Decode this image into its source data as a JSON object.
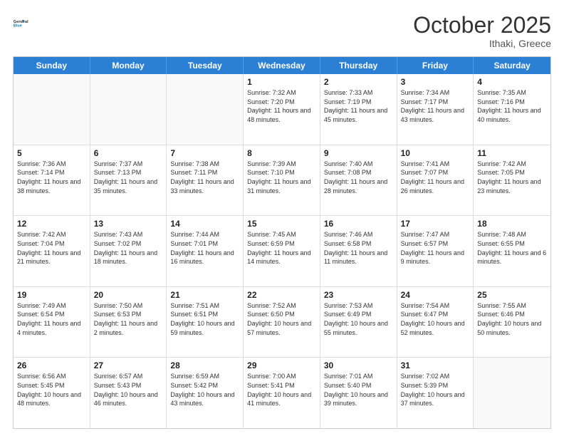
{
  "logo": {
    "line1": "General",
    "line2": "Blue"
  },
  "header": {
    "month": "October 2025",
    "location": "Ithaki, Greece"
  },
  "weekdays": [
    "Sunday",
    "Monday",
    "Tuesday",
    "Wednesday",
    "Thursday",
    "Friday",
    "Saturday"
  ],
  "rows": [
    [
      {
        "day": "",
        "info": ""
      },
      {
        "day": "",
        "info": ""
      },
      {
        "day": "",
        "info": ""
      },
      {
        "day": "1",
        "info": "Sunrise: 7:32 AM\nSunset: 7:20 PM\nDaylight: 11 hours and 48 minutes."
      },
      {
        "day": "2",
        "info": "Sunrise: 7:33 AM\nSunset: 7:19 PM\nDaylight: 11 hours and 45 minutes."
      },
      {
        "day": "3",
        "info": "Sunrise: 7:34 AM\nSunset: 7:17 PM\nDaylight: 11 hours and 43 minutes."
      },
      {
        "day": "4",
        "info": "Sunrise: 7:35 AM\nSunset: 7:16 PM\nDaylight: 11 hours and 40 minutes."
      }
    ],
    [
      {
        "day": "5",
        "info": "Sunrise: 7:36 AM\nSunset: 7:14 PM\nDaylight: 11 hours and 38 minutes."
      },
      {
        "day": "6",
        "info": "Sunrise: 7:37 AM\nSunset: 7:13 PM\nDaylight: 11 hours and 35 minutes."
      },
      {
        "day": "7",
        "info": "Sunrise: 7:38 AM\nSunset: 7:11 PM\nDaylight: 11 hours and 33 minutes."
      },
      {
        "day": "8",
        "info": "Sunrise: 7:39 AM\nSunset: 7:10 PM\nDaylight: 11 hours and 31 minutes."
      },
      {
        "day": "9",
        "info": "Sunrise: 7:40 AM\nSunset: 7:08 PM\nDaylight: 11 hours and 28 minutes."
      },
      {
        "day": "10",
        "info": "Sunrise: 7:41 AM\nSunset: 7:07 PM\nDaylight: 11 hours and 26 minutes."
      },
      {
        "day": "11",
        "info": "Sunrise: 7:42 AM\nSunset: 7:05 PM\nDaylight: 11 hours and 23 minutes."
      }
    ],
    [
      {
        "day": "12",
        "info": "Sunrise: 7:42 AM\nSunset: 7:04 PM\nDaylight: 11 hours and 21 minutes."
      },
      {
        "day": "13",
        "info": "Sunrise: 7:43 AM\nSunset: 7:02 PM\nDaylight: 11 hours and 18 minutes."
      },
      {
        "day": "14",
        "info": "Sunrise: 7:44 AM\nSunset: 7:01 PM\nDaylight: 11 hours and 16 minutes."
      },
      {
        "day": "15",
        "info": "Sunrise: 7:45 AM\nSunset: 6:59 PM\nDaylight: 11 hours and 14 minutes."
      },
      {
        "day": "16",
        "info": "Sunrise: 7:46 AM\nSunset: 6:58 PM\nDaylight: 11 hours and 11 minutes."
      },
      {
        "day": "17",
        "info": "Sunrise: 7:47 AM\nSunset: 6:57 PM\nDaylight: 11 hours and 9 minutes."
      },
      {
        "day": "18",
        "info": "Sunrise: 7:48 AM\nSunset: 6:55 PM\nDaylight: 11 hours and 6 minutes."
      }
    ],
    [
      {
        "day": "19",
        "info": "Sunrise: 7:49 AM\nSunset: 6:54 PM\nDaylight: 11 hours and 4 minutes."
      },
      {
        "day": "20",
        "info": "Sunrise: 7:50 AM\nSunset: 6:53 PM\nDaylight: 11 hours and 2 minutes."
      },
      {
        "day": "21",
        "info": "Sunrise: 7:51 AM\nSunset: 6:51 PM\nDaylight: 10 hours and 59 minutes."
      },
      {
        "day": "22",
        "info": "Sunrise: 7:52 AM\nSunset: 6:50 PM\nDaylight: 10 hours and 57 minutes."
      },
      {
        "day": "23",
        "info": "Sunrise: 7:53 AM\nSunset: 6:49 PM\nDaylight: 10 hours and 55 minutes."
      },
      {
        "day": "24",
        "info": "Sunrise: 7:54 AM\nSunset: 6:47 PM\nDaylight: 10 hours and 52 minutes."
      },
      {
        "day": "25",
        "info": "Sunrise: 7:55 AM\nSunset: 6:46 PM\nDaylight: 10 hours and 50 minutes."
      }
    ],
    [
      {
        "day": "26",
        "info": "Sunrise: 6:56 AM\nSunset: 5:45 PM\nDaylight: 10 hours and 48 minutes."
      },
      {
        "day": "27",
        "info": "Sunrise: 6:57 AM\nSunset: 5:43 PM\nDaylight: 10 hours and 46 minutes."
      },
      {
        "day": "28",
        "info": "Sunrise: 6:59 AM\nSunset: 5:42 PM\nDaylight: 10 hours and 43 minutes."
      },
      {
        "day": "29",
        "info": "Sunrise: 7:00 AM\nSunset: 5:41 PM\nDaylight: 10 hours and 41 minutes."
      },
      {
        "day": "30",
        "info": "Sunrise: 7:01 AM\nSunset: 5:40 PM\nDaylight: 10 hours and 39 minutes."
      },
      {
        "day": "31",
        "info": "Sunrise: 7:02 AM\nSunset: 5:39 PM\nDaylight: 10 hours and 37 minutes."
      },
      {
        "day": "",
        "info": ""
      }
    ]
  ]
}
